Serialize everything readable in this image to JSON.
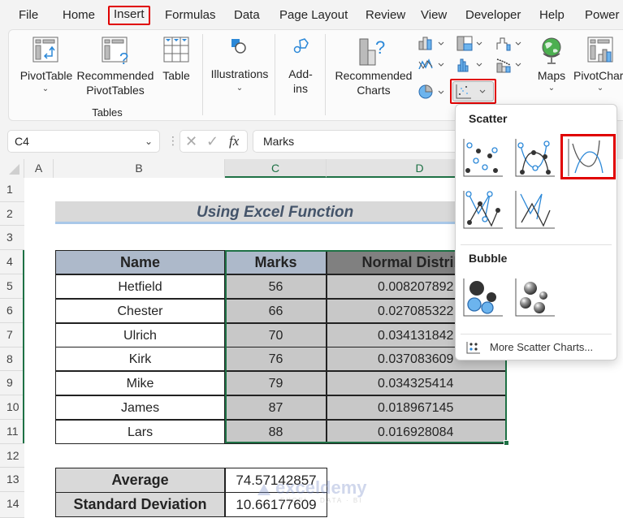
{
  "menu": {
    "tabs": [
      "File",
      "Home",
      "Insert",
      "Formulas",
      "Data",
      "Page Layout",
      "Review",
      "View",
      "Developer",
      "Help",
      "Power"
    ],
    "active_tab": "Insert"
  },
  "ribbon": {
    "pivottable": "PivotTable",
    "recommended_pivottables_1": "Recommended",
    "recommended_pivottables_2": "PivotTables",
    "table": "Table",
    "tables_group": "Tables",
    "illustrations": "Illustrations",
    "addins_1": "Add-",
    "addins_2": "ins",
    "recommended_charts_1": "Recommended",
    "recommended_charts_2": "Charts",
    "maps": "Maps",
    "pivotchart": "PivotChar",
    "chevron": "⌄"
  },
  "formula_bar": {
    "name_box": "C4",
    "fx": "fx",
    "formula": "Marks"
  },
  "columns": [
    "A",
    "B",
    "C",
    "D"
  ],
  "rows": [
    "1",
    "2",
    "3",
    "4",
    "5",
    "6",
    "7",
    "8",
    "9",
    "10",
    "11",
    "12",
    "13",
    "14"
  ],
  "sheet": {
    "title": "Using Excel Function",
    "table_headers": [
      "Name",
      "Marks",
      "Normal Distribu"
    ],
    "table_rows": [
      {
        "name": "Hetfield",
        "marks": "56",
        "nd": "0.008207892"
      },
      {
        "name": "Chester",
        "marks": "66",
        "nd": "0.027085322"
      },
      {
        "name": "Ulrich",
        "marks": "70",
        "nd": "0.034131842"
      },
      {
        "name": "Kirk",
        "marks": "76",
        "nd": "0.037083609"
      },
      {
        "name": "Mike",
        "marks": "79",
        "nd": "0.034325414"
      },
      {
        "name": "James",
        "marks": "87",
        "nd": "0.018967145"
      },
      {
        "name": "Lars",
        "marks": "88",
        "nd": "0.016928084"
      }
    ],
    "stats": [
      {
        "label": "Average",
        "value": "74.57142857"
      },
      {
        "label": "Standard Deviation",
        "value": "10.66177609"
      }
    ]
  },
  "dropdown": {
    "scatter_title": "Scatter",
    "bubble_title": "Bubble",
    "more_link": "More Scatter Charts..."
  },
  "watermark": {
    "brand": "exceldemy",
    "tagline": "EXCEL · DATA · BI"
  },
  "colors": {
    "accent_green": "#1e7145",
    "highlight_red": "#e00000",
    "header_blue": "#adb9ca",
    "selected_gray": "#c8c8c8"
  }
}
